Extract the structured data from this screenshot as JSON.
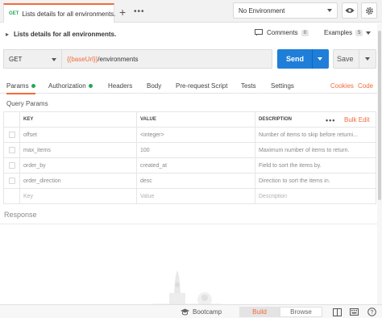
{
  "tab": {
    "method": "GET",
    "title": "Lists details for all environments."
  },
  "environment": {
    "selected": "No Environment"
  },
  "request": {
    "title": "Lists details for all environments.",
    "comments_label": "Comments",
    "comments_count": "0",
    "examples_label": "Examples",
    "examples_count": "5"
  },
  "url_bar": {
    "method": "GET",
    "url_var": "{{baseUrl}}",
    "url_path": "/environments",
    "send_label": "Send",
    "save_label": "Save"
  },
  "subtabs": [
    {
      "label": "Params"
    },
    {
      "label": "Authorization"
    },
    {
      "label": "Headers"
    },
    {
      "label": "Body"
    },
    {
      "label": "Pre-request Script"
    },
    {
      "label": "Tests"
    },
    {
      "label": "Settings"
    }
  ],
  "links": {
    "cookies": "Cookies",
    "code": "Code"
  },
  "query_params": {
    "title": "Query Params",
    "columns": [
      "KEY",
      "VALUE",
      "DESCRIPTION"
    ],
    "bulk_edit": "Bulk Edit",
    "rows": [
      {
        "key": "offset",
        "value": "<integer>",
        "description": "Number of items to skip before returni..."
      },
      {
        "key": "max_items",
        "value": "100",
        "description": "Maximum number of items to return."
      },
      {
        "key": "order_by",
        "value": "created_at",
        "description": "Field to sort the items by."
      },
      {
        "key": "order_direction",
        "value": "desc",
        "description": "Direction to sort the items in."
      }
    ],
    "placeholder": {
      "key": "Key",
      "value": "Value",
      "description": "Description"
    }
  },
  "response": {
    "label": "Response"
  },
  "statusbar": {
    "bootcamp": "Bootcamp",
    "build": "Build",
    "browse": "Browse"
  },
  "colors": {
    "accent": "#f26b3a",
    "send": "#1e7ed8",
    "ok_dot": "#26a65b"
  },
  "icons": [
    "plus-icon",
    "more-icon",
    "eye-icon",
    "gear-icon",
    "chevron-right-icon",
    "comment-icon",
    "caret-down-icon",
    "rocket-icon",
    "bootcamp-icon",
    "two-pane-icon",
    "keyboard-icon",
    "help-icon"
  ]
}
